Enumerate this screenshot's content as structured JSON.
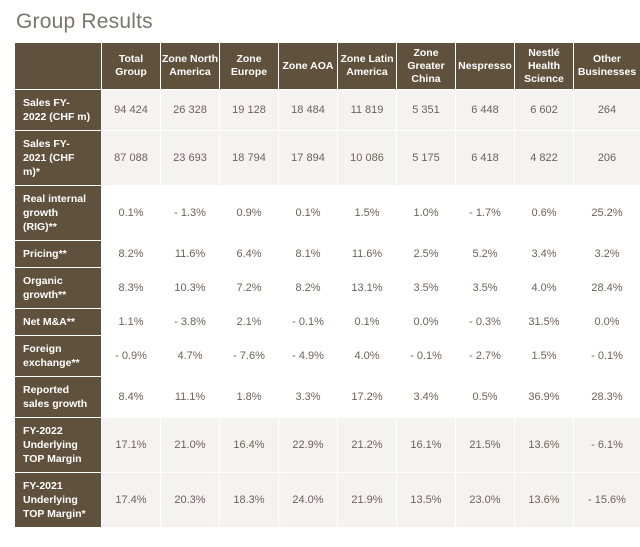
{
  "page": {
    "title": "Group Results"
  },
  "table": {
    "corner_label": "",
    "columns": [
      "Total Group",
      "Zone North America",
      "Zone Europe",
      "Zone AOA",
      "Zone Latin America",
      "Zone Greater China",
      "Nespresso",
      "Nestlé Health Science",
      "Other Businesses"
    ],
    "rows": [
      {
        "label": "Sales FY-2022 (CHF m)",
        "shaded": true,
        "values": [
          "94 424",
          "26 328",
          "19 128",
          "18 484",
          "11 819",
          "5 351",
          "6 448",
          "6 602",
          "264"
        ]
      },
      {
        "label": "Sales FY-2021 (CHF m)*",
        "shaded": true,
        "values": [
          "87 088",
          "23 693",
          "18 794",
          "17 894",
          "10 086",
          "5 175",
          "6 418",
          "4 822",
          "206"
        ]
      },
      {
        "label": "Real internal growth (RIG)**",
        "shaded": false,
        "values": [
          "0.1%",
          "- 1.3%",
          "0.9%",
          "0.1%",
          "1.5%",
          "1.0%",
          "- 1.7%",
          "0.6%",
          "25.2%"
        ]
      },
      {
        "label": "Pricing**",
        "shaded": false,
        "values": [
          "8.2%",
          "11.6%",
          "6.4%",
          "8.1%",
          "11.6%",
          "2.5%",
          "5.2%",
          "3.4%",
          "3.2%"
        ]
      },
      {
        "label": "Organic growth**",
        "shaded": false,
        "values": [
          "8.3%",
          "10.3%",
          "7.2%",
          "8.2%",
          "13.1%",
          "3.5%",
          "3.5%",
          "4.0%",
          "28.4%"
        ]
      },
      {
        "label": "Net M&A**",
        "shaded": false,
        "values": [
          "1.1%",
          "- 3.8%",
          "2.1%",
          "- 0.1%",
          "0.1%",
          "0.0%",
          "- 0.3%",
          "31.5%",
          "0.0%"
        ]
      },
      {
        "label": "Foreign exchange**",
        "shaded": false,
        "values": [
          "- 0.9%",
          "4.7%",
          "- 7.6%",
          "- 4.9%",
          "4.0%",
          "- 0.1%",
          "- 2.7%",
          "1.5%",
          "- 0.1%"
        ]
      },
      {
        "label": "Reported sales growth",
        "shaded": false,
        "values": [
          "8.4%",
          "11.1%",
          "1.8%",
          "3.3%",
          "17.2%",
          "3.4%",
          "0.5%",
          "36.9%",
          "28.3%"
        ]
      },
      {
        "label": "FY-2022 Underlying TOP Margin",
        "shaded": true,
        "values": [
          "17.1%",
          "21.0%",
          "16.4%",
          "22.9%",
          "21.2%",
          "16.1%",
          "21.5%",
          "13.6%",
          "- 6.1%"
        ]
      },
      {
        "label": "FY-2021 Underlying TOP Margin*",
        "shaded": true,
        "values": [
          "17.4%",
          "20.3%",
          "18.3%",
          "24.0%",
          "21.9%",
          "13.5%",
          "23.0%",
          "13.6%",
          "- 15.6%"
        ]
      }
    ]
  },
  "colors": {
    "header_brown": "#60513d",
    "value_text": "#6e6257",
    "shaded_row": "#f4f3f1",
    "title_text": "#7b756c"
  }
}
